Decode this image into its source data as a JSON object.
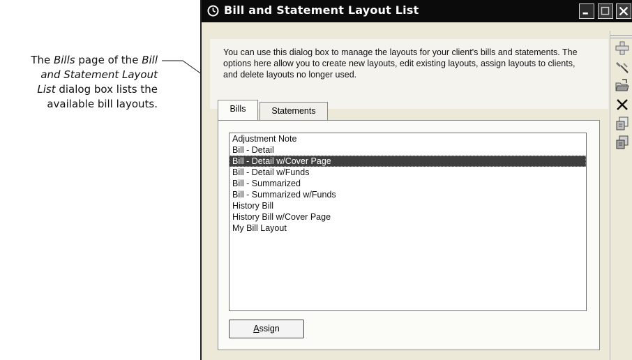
{
  "callout": {
    "prefix": "The ",
    "bills_word": "Bills",
    "middle1": " page of the ",
    "title_line1": "Bill",
    "title_line2": "and Statement Layout",
    "title_line3": "List",
    "suffix": " dialog box lists the available bill layouts."
  },
  "window": {
    "title": "Bill and Statement Layout List"
  },
  "description": "You can use this dialog box to manage the layouts for your client's bills and statements. The options here allow you to create new layouts, edit existing layouts, assign layouts to clients, and delete layouts no longer used.",
  "tabs": [
    {
      "label": "Bills"
    },
    {
      "label": "Statements"
    }
  ],
  "layouts": [
    "Adjustment Note",
    "Bill - Detail",
    "Bill - Detail w/Cover Page",
    "Bill - Detail w/Funds",
    "Bill - Summarized",
    "Bill - Summarized w/Funds",
    "History Bill",
    "History Bill w/Cover Page",
    "My Bill Layout"
  ],
  "selected_layout": "Bill - Detail w/Cover Page",
  "assign_button": {
    "mnemonic": "A",
    "rest": "ssign"
  },
  "toolbar_icons": [
    "add-icon",
    "edit-icon",
    "open-folder-icon",
    "delete-icon",
    "import-icon",
    "export-icon"
  ]
}
